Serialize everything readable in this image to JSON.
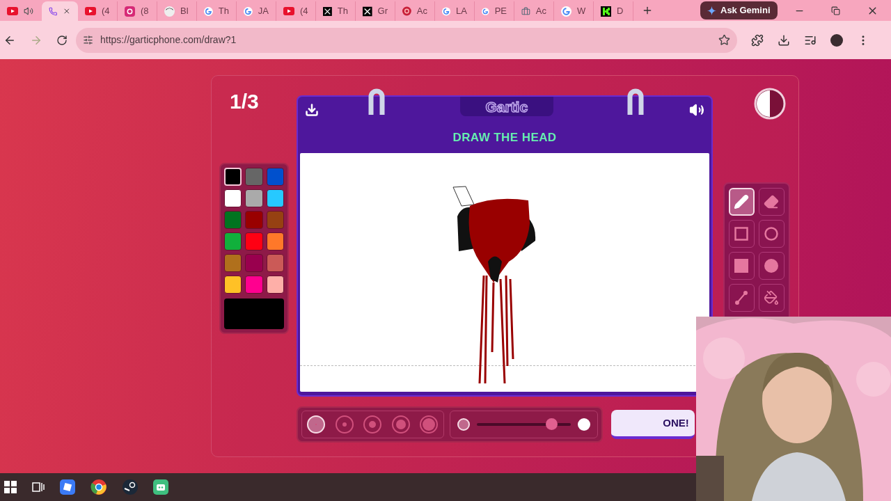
{
  "browser": {
    "tabs": [
      {
        "kind": "youtube",
        "audio": true,
        "selected": false
      },
      {
        "kind": "phone",
        "selected": true
      },
      {
        "kind": "youtube",
        "title": "(4",
        "selected": false
      },
      {
        "kind": "instagram",
        "title": "(8",
        "selected": false
      },
      {
        "kind": "avatar",
        "title": "Bl",
        "selected": false
      },
      {
        "kind": "google",
        "title": "Th",
        "selected": false
      },
      {
        "kind": "google",
        "title": "JA",
        "selected": false
      },
      {
        "kind": "youtube",
        "title": "(4",
        "selected": false
      },
      {
        "kind": "x",
        "title": "Th",
        "selected": false
      },
      {
        "kind": "x",
        "title": "Gr",
        "selected": false
      },
      {
        "kind": "swirl",
        "title": "Ac",
        "selected": false
      },
      {
        "kind": "google",
        "title": "LA",
        "selected": false
      },
      {
        "kind": "google",
        "title": "PE",
        "selected": false
      },
      {
        "kind": "briefcase",
        "title": "Ac",
        "selected": false
      },
      {
        "kind": "google",
        "title": "W",
        "selected": false
      },
      {
        "kind": "kick",
        "title": "D",
        "selected": false
      }
    ],
    "ask_gemini": "Ask Gemini",
    "url": "https://garticphone.com/draw?1"
  },
  "game": {
    "round": "1/3",
    "logo": "Gartic",
    "prompt": "DRAW THE HEAD",
    "palette": [
      {
        "color": "#000000",
        "selected": true
      },
      {
        "color": "#666666",
        "selected": false
      },
      {
        "color": "#0050cd",
        "selected": false
      },
      {
        "color": "#ffffff",
        "selected": false
      },
      {
        "color": "#aaaaaa",
        "selected": false
      },
      {
        "color": "#26c9ff",
        "selected": false
      },
      {
        "color": "#017420",
        "selected": false
      },
      {
        "color": "#990000",
        "selected": false
      },
      {
        "color": "#964112",
        "selected": false
      },
      {
        "color": "#11b03c",
        "selected": false
      },
      {
        "color": "#ff0013",
        "selected": false
      },
      {
        "color": "#ff7829",
        "selected": false
      },
      {
        "color": "#b0701c",
        "selected": false
      },
      {
        "color": "#99004e",
        "selected": false
      },
      {
        "color": "#cb5a57",
        "selected": false
      },
      {
        "color": "#ffc126",
        "selected": false
      },
      {
        "color": "#ff008f",
        "selected": false
      },
      {
        "color": "#feafa8",
        "selected": false
      }
    ],
    "tools": [
      {
        "kind": "pencil",
        "selected": true
      },
      {
        "kind": "eraser",
        "selected": false
      },
      {
        "kind": "rectangle",
        "selected": false
      },
      {
        "kind": "ellipse",
        "selected": false
      },
      {
        "kind": "filled-rectangle",
        "selected": false
      },
      {
        "kind": "filled-ellipse",
        "selected": false
      },
      {
        "kind": "line",
        "selected": false
      },
      {
        "kind": "bucket",
        "selected": false
      }
    ],
    "brush_sizes": [
      {
        "selected": true
      },
      {
        "selected": false
      },
      {
        "selected": false
      },
      {
        "selected": false
      },
      {
        "selected": false
      }
    ],
    "opacity": {
      "level": 0.84
    },
    "done_button": "ONE!"
  }
}
